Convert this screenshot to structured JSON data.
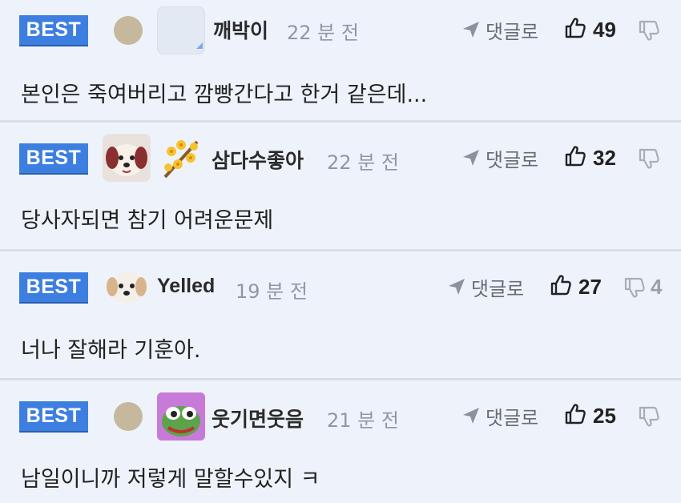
{
  "colors": {
    "background": "#eef3fb",
    "badge": "#3d7fe0",
    "divider": "#d9dde4",
    "muted": "#8f97a3"
  },
  "comments": [
    {
      "badge": "BEST",
      "avatar": "grey-dot",
      "level_icon": "blank-emblem-icon",
      "nickname": "깨박이",
      "time": "22 분 전",
      "reply_label": "댓글로",
      "likes": "49",
      "dislikes": "",
      "text": "본인은 죽여버리고 깜빵간다고 한거 같은데..."
    },
    {
      "badge": "BEST",
      "avatar": "puppy-face",
      "level_icon": "flower-branch-icon",
      "nickname": "삼다수좋아",
      "time": "22 분 전",
      "reply_label": "댓글로",
      "likes": "32",
      "dislikes": "",
      "text": "당사자되면 참기 어려운문제"
    },
    {
      "badge": "BEST",
      "avatar": "puppy-face",
      "level_icon": "",
      "nickname": "Yelled",
      "time": "19 분 전",
      "reply_label": "댓글로",
      "likes": "27",
      "dislikes": "4",
      "text": "너나 잘해라 기훈아."
    },
    {
      "badge": "BEST",
      "avatar": "grey-dot",
      "level_icon": "frog-face-icon",
      "nickname": "웃기면웃음",
      "time": "21 분 전",
      "reply_label": "댓글로",
      "likes": "25",
      "dislikes": "",
      "text": "남일이니까 저렇게 말할수있지 ㅋ"
    }
  ]
}
